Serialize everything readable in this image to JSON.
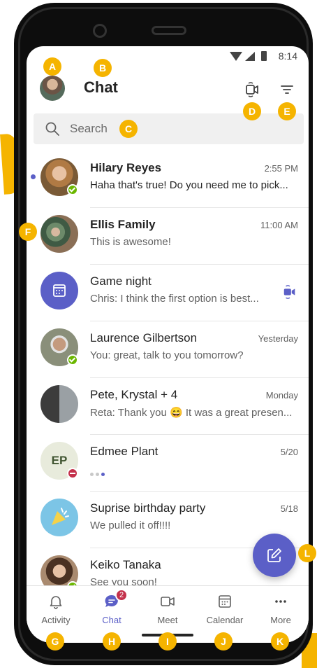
{
  "status_bar": {
    "time": "8:14"
  },
  "header": {
    "title": "Chat"
  },
  "search": {
    "placeholder": "Search"
  },
  "chats": [
    {
      "name": "Hilary Reyes",
      "message": "Haha that's true! Do you need me to pick...",
      "time": "2:55 PM",
      "unread": true,
      "presence": "available",
      "avatar": "photo"
    },
    {
      "name": "Ellis Family",
      "message": "This is awesome!",
      "time": "11:00 AM",
      "unread": false,
      "presence": "none",
      "avatar": "photo"
    },
    {
      "name": "Game night",
      "message": "Chris: I think the first option is best...",
      "time": "",
      "unread": false,
      "presence": "none",
      "avatar": "calendar-icon",
      "trailing_icon": "video-icon"
    },
    {
      "name": "Laurence Gilbertson",
      "message": "You: great, talk to you tomorrow?",
      "time": "Yesterday",
      "unread": false,
      "presence": "available",
      "avatar": "photo"
    },
    {
      "name": "Pete, Krystal + 4",
      "message_prefix": "Reta: Thank you",
      "emoji": "😄",
      "message_suffix": "It was a great presen...",
      "time": "Monday",
      "unread": false,
      "presence": "none",
      "avatar": "group-photo"
    },
    {
      "name": "Edmee Plant",
      "initials": "EP",
      "message": "",
      "time": "5/20",
      "unread": false,
      "presence": "dnd",
      "typing": true
    },
    {
      "name": "Suprise birthday party",
      "message": "We pulled it off!!!!",
      "time": "5/18",
      "unread": false,
      "presence": "none",
      "avatar": "party-icon"
    },
    {
      "name": "Keiko Tanaka",
      "message": "See you soon!",
      "time": "",
      "unread": false,
      "presence": "available",
      "avatar": "photo"
    }
  ],
  "nav": [
    {
      "label": "Activity",
      "icon": "bell-icon",
      "active": false
    },
    {
      "label": "Chat",
      "icon": "chat-icon",
      "active": true,
      "badge": "2"
    },
    {
      "label": "Meet",
      "icon": "video-icon",
      "active": false
    },
    {
      "label": "Calendar",
      "icon": "calendar-icon",
      "active": false
    },
    {
      "label": "More",
      "icon": "more-icon",
      "active": false
    }
  ],
  "callouts": [
    "A",
    "B",
    "C",
    "D",
    "E",
    "F",
    "G",
    "H",
    "I",
    "J",
    "K",
    "L"
  ],
  "colors": {
    "accent": "#5b5fc7",
    "callout": "#f5b400",
    "available": "#6bb700",
    "dnd": "#c4314b"
  }
}
